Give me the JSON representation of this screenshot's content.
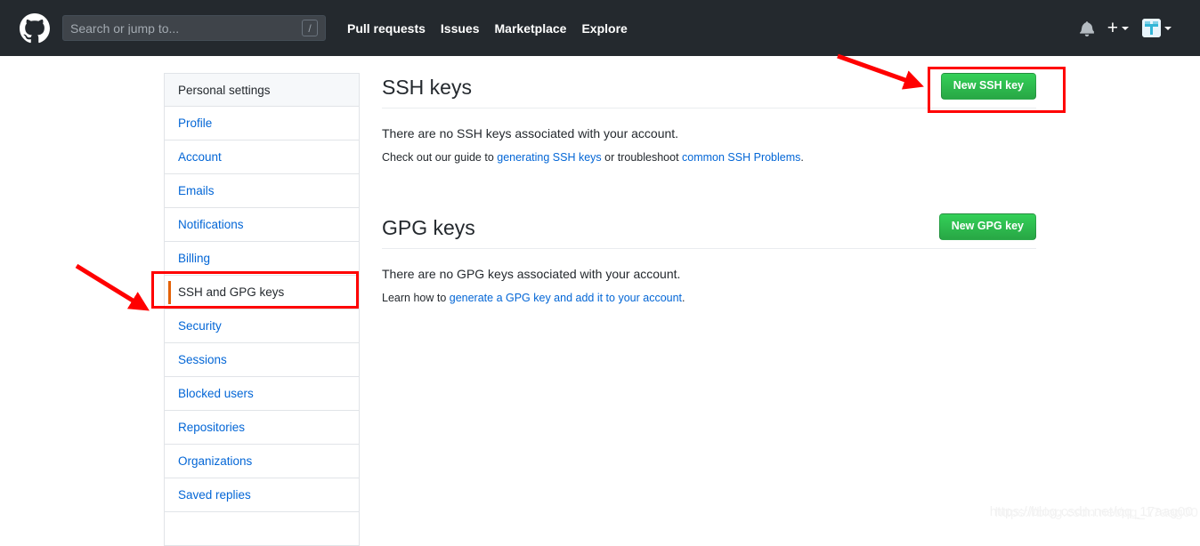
{
  "header": {
    "logo_icon": "github-logo-icon",
    "search": {
      "placeholder": "Search or jump to...",
      "shortcut_badge": "/"
    },
    "nav_links": [
      {
        "label": "Pull requests"
      },
      {
        "label": "Issues"
      },
      {
        "label": "Marketplace"
      },
      {
        "label": "Explore"
      }
    ],
    "right": {
      "notifications_icon": "bell-icon",
      "create_new_label": "+",
      "create_new_caret_icon": "chevron-down-icon",
      "avatar_icon": "avatar-image",
      "avatar_caret_icon": "chevron-down-icon"
    },
    "background_color": "#24292e"
  },
  "sidebar": {
    "title": "Personal settings",
    "items": [
      {
        "label": "Profile",
        "selected": false
      },
      {
        "label": "Account",
        "selected": false
      },
      {
        "label": "Emails",
        "selected": false
      },
      {
        "label": "Notifications",
        "selected": false
      },
      {
        "label": "Billing",
        "selected": false
      },
      {
        "label": "SSH and GPG keys",
        "selected": true
      },
      {
        "label": "Security",
        "selected": false
      },
      {
        "label": "Sessions",
        "selected": false
      },
      {
        "label": "Blocked users",
        "selected": false
      },
      {
        "label": "Repositories",
        "selected": false
      },
      {
        "label": "Organizations",
        "selected": false
      },
      {
        "label": "Saved replies",
        "selected": false
      }
    ],
    "selected_accent_color": "#e36209",
    "link_color": "#0366d6"
  },
  "main": {
    "ssh": {
      "title": "SSH keys",
      "button_label": "New SSH key",
      "empty_text": "There are no SSH keys associated with your account.",
      "help_prefix": "Check out our guide to ",
      "help_link1": "generating SSH keys",
      "help_middle": " or troubleshoot ",
      "help_link2": "common SSH Problems",
      "help_suffix": "."
    },
    "gpg": {
      "title": "GPG keys",
      "button_label": "New GPG key",
      "empty_text": "There are no GPG keys associated with your account.",
      "help_prefix": "Learn how to ",
      "help_link1": "generate a GPG key and add it to your account",
      "help_suffix": "."
    },
    "button_color": "#28a745"
  },
  "annotations": {
    "color": "#ff0000",
    "boxes": [
      {
        "name": "new-ssh-key-button-highlight"
      },
      {
        "name": "ssh-and-gpg-keys-sidebar-highlight"
      }
    ],
    "arrows": [
      {
        "name": "arrow-to-new-ssh-key-button"
      },
      {
        "name": "arrow-to-sidebar-item"
      }
    ]
  },
  "watermark": {
    "text": "https://blog.csdn.net/qq_17aag00"
  }
}
